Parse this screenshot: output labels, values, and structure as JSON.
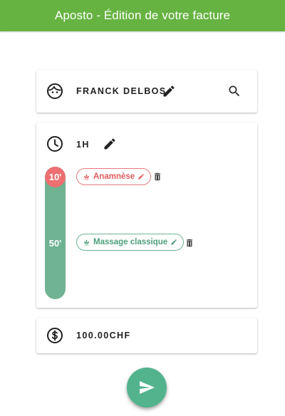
{
  "appbar": {
    "title": "Aposto - Édition de votre facture",
    "color": "#66b342"
  },
  "client": {
    "icon": "face-icon",
    "name": "FRANCK DELBOS",
    "edit_icon": "pencil-icon",
    "search_icon": "search-icon"
  },
  "session": {
    "icon": "clock-icon",
    "duration": "1H",
    "edit_icon": "pencil-icon",
    "timeline": {
      "segments": [
        {
          "label": "10'",
          "minutes": 10,
          "color": "#ee6f71"
        },
        {
          "label": "50'",
          "minutes": 50,
          "color": "#6fb393"
        }
      ]
    },
    "items": [
      {
        "label": "Anamnèse",
        "icon": "lotus-icon",
        "edit_icon": "pencil-icon",
        "delete_icon": "trash-icon",
        "color": "#e05b5e"
      },
      {
        "label": "Massage classique",
        "icon": "lotus-icon",
        "edit_icon": "pencil-icon",
        "delete_icon": "trash-icon",
        "color": "#4e9f7b"
      }
    ]
  },
  "price": {
    "icon": "dollar-circle-icon",
    "amount": "100.00CHF"
  },
  "fab": {
    "icon": "send-icon",
    "color": "#52b38d"
  }
}
